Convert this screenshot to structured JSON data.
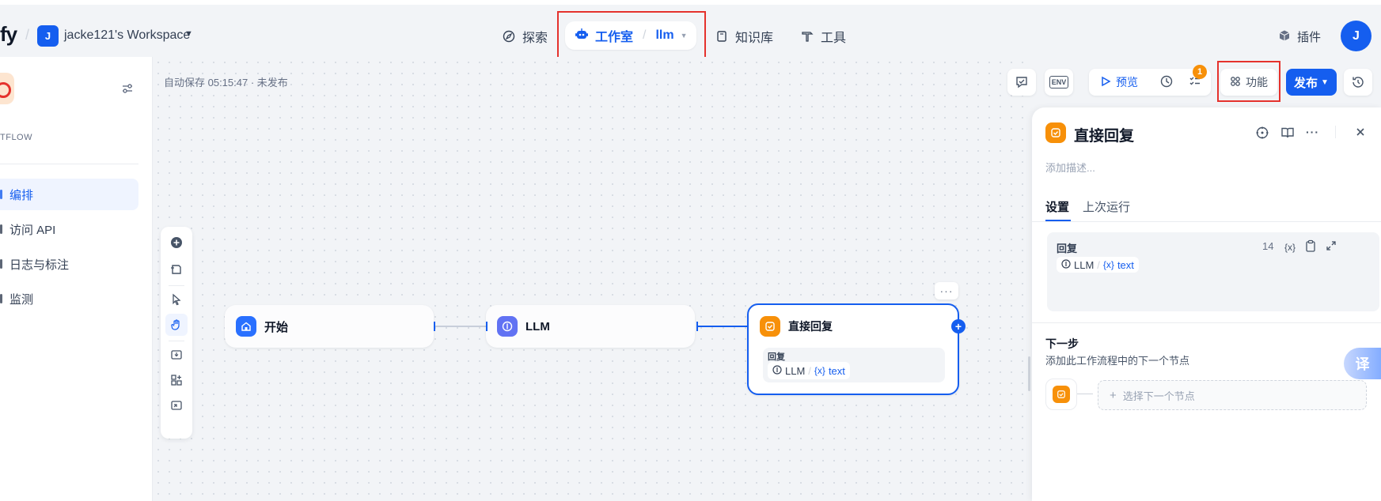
{
  "brand": {
    "text": "fy"
  },
  "workspace": {
    "avatar": "J",
    "name": "jacke121's Workspace"
  },
  "nav": {
    "explore": "探索",
    "studio": "工作室",
    "app_name": "llm",
    "knowledge": "知识库",
    "tools": "工具",
    "plugins": "插件"
  },
  "user": {
    "avatar": "J"
  },
  "sidebar": {
    "app_type": "TFLOW",
    "items": [
      {
        "label": "编排",
        "active": true
      },
      {
        "label": "访问 API",
        "active": false
      },
      {
        "label": "日志与标注",
        "active": false
      },
      {
        "label": "监测",
        "active": false
      }
    ]
  },
  "canvas": {
    "autosave": "自动保存 05:15:47 · 未发布",
    "toolbar": {
      "preview": "预览",
      "features": "功能",
      "publish": "发布",
      "badge": "1",
      "env": "ENV"
    },
    "nodes": {
      "start": {
        "title": "开始"
      },
      "llm": {
        "title": "LLM"
      },
      "answer": {
        "title": "直接回复",
        "field_label": "回复",
        "var_source": "LLM",
        "var_name": "text",
        "var_prefix": "{x}",
        "more": "···"
      }
    }
  },
  "panel": {
    "title": "直接回复",
    "desc_placeholder": "添加描述...",
    "tabs": [
      "设置",
      "上次运行"
    ],
    "reply": {
      "label": "回复",
      "count": "14",
      "var_tool": "{x}",
      "var_source": "LLM",
      "var_name": "text",
      "var_prefix": "{x}"
    },
    "next": {
      "title": "下一步",
      "desc": "添加此工作流程中的下一个节点",
      "select": "选择下一个节点",
      "plus": "+"
    }
  },
  "translate_btn": "译",
  "colors": {
    "primary": "#155eef",
    "orange": "#f79009",
    "highlight": "#e5322d"
  }
}
